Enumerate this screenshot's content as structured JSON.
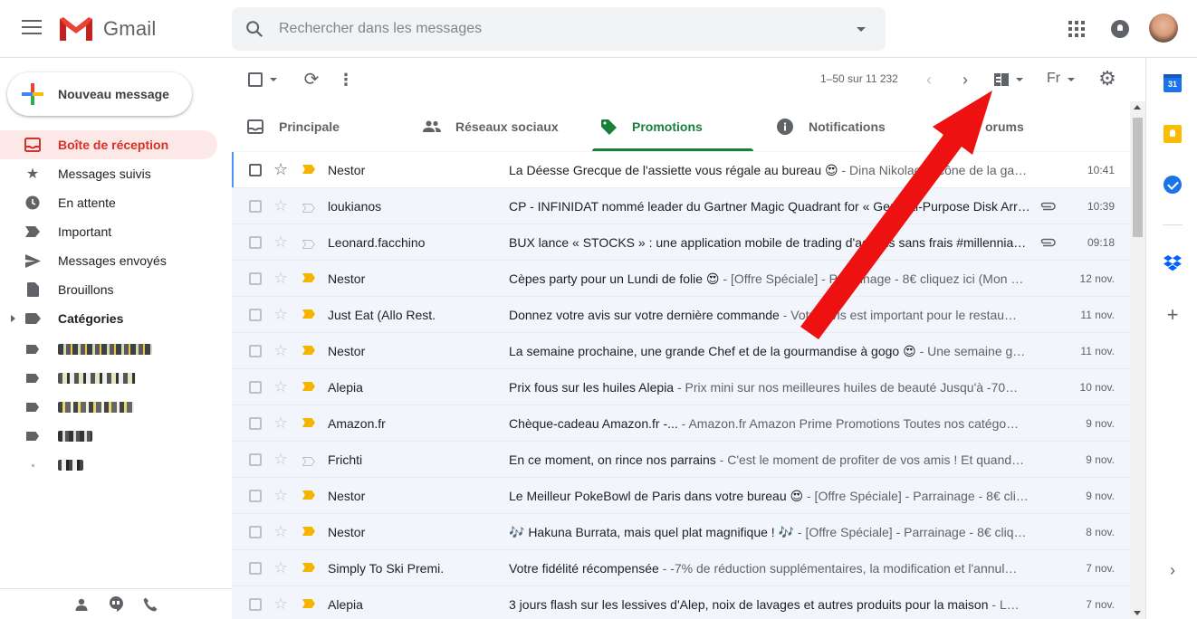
{
  "header": {
    "app_name": "Gmail",
    "search_placeholder": "Rechercher dans les messages"
  },
  "sidebar": {
    "compose_label": "Nouveau message",
    "items": [
      {
        "label": "Boîte de réception",
        "icon": "inbox-icon",
        "active": true
      },
      {
        "label": "Messages suivis",
        "icon": "star-icon"
      },
      {
        "label": "En attente",
        "icon": "clock-icon"
      },
      {
        "label": "Important",
        "icon": "important-icon"
      },
      {
        "label": "Messages envoyés",
        "icon": "send-icon"
      },
      {
        "label": "Brouillons",
        "icon": "draft-icon"
      },
      {
        "label": "Catégories",
        "icon": "label-icon"
      }
    ],
    "footer_icons": [
      "person-icon",
      "hangouts-icon",
      "phone-icon"
    ]
  },
  "toolbar": {
    "pagination": "1–50 sur 11 232",
    "language": "Fr"
  },
  "tabs": [
    {
      "label": "Principale",
      "icon": "inbox-icon"
    },
    {
      "label": "Réseaux sociaux",
      "icon": "people-icon"
    },
    {
      "label": "Promotions",
      "icon": "tag-icon",
      "active": true
    },
    {
      "label": "Notifications",
      "icon": "info-icon"
    },
    {
      "label": "orums",
      "icon": "forum-icon"
    }
  ],
  "colors": {
    "accent_red": "#d93025",
    "promotions_green": "#188038",
    "important_yellow": "#f4b400",
    "arrow_red": "#ee1111"
  },
  "emails": [
    {
      "sender": "Nestor",
      "subject": "La Déesse Grecque de l'assiette vous régale au bureau 😍",
      "snippet": " - Dina Nikolaou, icône de la ga…",
      "date": "10:41",
      "important": true,
      "attachment": false
    },
    {
      "sender": "loukianos",
      "subject": "CP - INFINIDAT nommé leader du Gartner Magic Quadrant for « General-Purpose Disk Arr…",
      "snippet": "",
      "date": "10:39",
      "important": false,
      "attachment": true
    },
    {
      "sender": "Leonard.facchino",
      "subject": "BUX lance « STOCKS » : une application mobile de trading d'actions sans frais #millennia…",
      "snippet": "",
      "date": "09:18",
      "important": false,
      "attachment": true
    },
    {
      "sender": "Nestor",
      "subject": "Cèpes party pour un Lundi de folie 😍",
      "snippet": " - [Offre Spéciale] - Parrainage - 8€ cliquez ici (Mon …",
      "date": "12 nov.",
      "important": true,
      "attachment": false
    },
    {
      "sender": "Just Eat (Allo Rest.",
      "subject": "Donnez votre avis sur votre dernière commande",
      "snippet": " - Votre avis est important pour le restau…",
      "date": "11 nov.",
      "important": true,
      "attachment": false
    },
    {
      "sender": "Nestor",
      "subject": "La semaine prochaine, une grande Chef et de la gourmandise à gogo 😍",
      "snippet": " - Une semaine g…",
      "date": "11 nov.",
      "important": true,
      "attachment": false
    },
    {
      "sender": "Alepia",
      "subject": "Prix fous sur les huiles Alepia",
      "snippet": " - Prix mini sur nos meilleures huiles de beauté Jusqu'à -70…",
      "date": "10 nov.",
      "important": true,
      "attachment": false
    },
    {
      "sender": "Amazon.fr",
      "subject": "Chèque-cadeau Amazon.fr -...",
      "snippet": " - Amazon.fr Amazon Prime Promotions Toutes nos catégo…",
      "date": "9 nov.",
      "important": true,
      "attachment": false
    },
    {
      "sender": "Frichti",
      "subject": "En ce moment, on rince nos parrains",
      "snippet": " - C'est le moment de profiter de vos amis ! Et quand…",
      "date": "9 nov.",
      "important": false,
      "attachment": false
    },
    {
      "sender": "Nestor",
      "subject": "Le Meilleur PokeBowl de Paris dans votre bureau 😍",
      "snippet": " - [Offre Spéciale] - Parrainage - 8€ cli…",
      "date": "9 nov.",
      "important": true,
      "attachment": false
    },
    {
      "sender": "Nestor",
      "subject": "🎶 Hakuna Burrata, mais quel plat magnifique ! 🎶",
      "snippet": " - [Offre Spéciale] - Parrainage - 8€ cliq…",
      "date": "8 nov.",
      "important": true,
      "attachment": false
    },
    {
      "sender": "Simply To Ski Premi.",
      "subject": "Votre fidélité récompensée",
      "snippet": " - -7% de réduction supplémentaires, la modification et l'annul…",
      "date": "7 nov.",
      "important": true,
      "attachment": false
    },
    {
      "sender": "Alepia",
      "subject": "3 jours flash sur les lessives d'Alep, noix de lavages et autres produits pour la maison",
      "snippet": " - L…",
      "date": "7 nov.",
      "important": true,
      "attachment": false
    }
  ],
  "side_panel": {
    "calendar_day": "31"
  }
}
